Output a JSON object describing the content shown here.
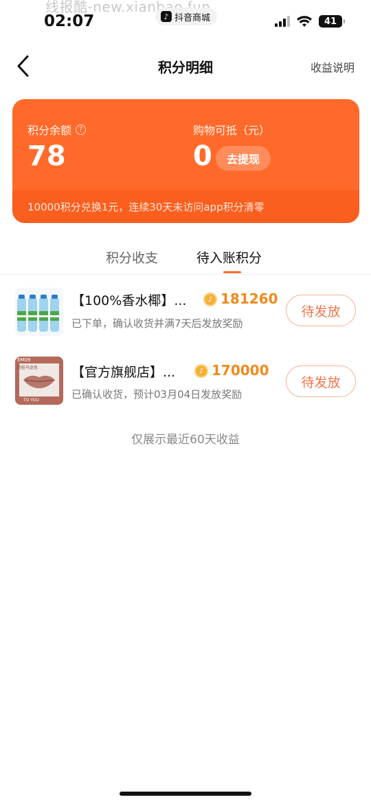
{
  "status_bar": {
    "watermark": "线报酷-new.xianbao.fun",
    "time": "02:07",
    "app_name": "抖音商城",
    "battery": "41"
  },
  "nav": {
    "title": "积分明细",
    "right_link": "收益说明"
  },
  "card": {
    "balance_label": "积分余额",
    "balance_value": "78",
    "deduct_label": "购物可抵（元）",
    "deduct_value": "0",
    "withdraw_label": "去提现",
    "note": "10000积分兑换1元，连续30天未访问app积分清零",
    "colors": {
      "card": "#ff6a2a",
      "footer": "#fa5f1f"
    }
  },
  "tabs": [
    {
      "label": "积分收支",
      "active": false
    },
    {
      "label": "待入账积分",
      "active": true
    }
  ],
  "items": [
    {
      "title": "【100%香水椰】...",
      "points": "181260",
      "subtitle": "已下单，确认收货并满7天后发放奖励",
      "status": "待发放",
      "thumb": "coconut-water-bottles"
    },
    {
      "title": "【官方旗舰店】...",
      "points": "170000",
      "subtitle": "已确认收货，预计03月04日发放奖励",
      "status": "待发放",
      "thumb": "lipstick-product",
      "thumb_text": {
        "code": "EM09",
        "line2": "肉桂乌龙色",
        "bottom": "TO YOU"
      }
    }
  ],
  "footer_note": "仅展示最近60天收益",
  "accent_color": "#ff6a2a",
  "points_color": "#f08a1c"
}
